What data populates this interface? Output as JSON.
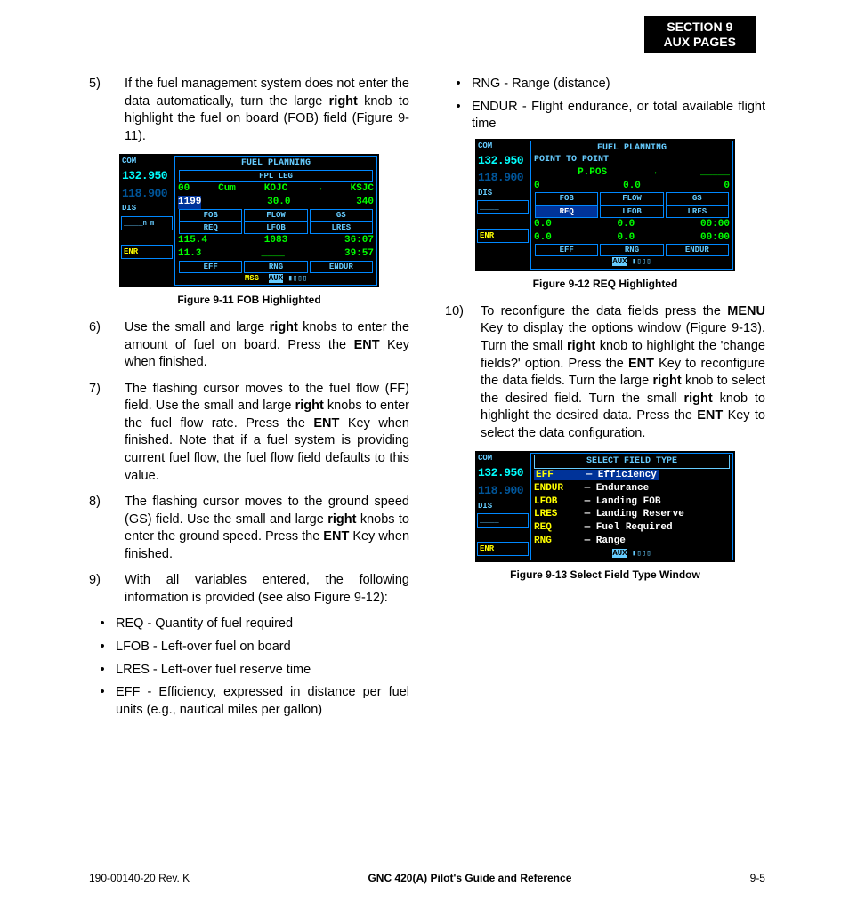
{
  "header": {
    "line1": "SECTION 9",
    "line2": "AUX PAGES"
  },
  "left": {
    "i5": {
      "n": "5)",
      "t": "If the fuel management system does not enter the data automatically, turn the large <b>right</b> knob to highlight the fuel on board (FOB) field (Figure 9-11)."
    },
    "fig11_cap": "Figure 9-11  FOB Highlighted",
    "i6": {
      "n": "6)",
      "t": "Use the small and large <b>right</b> knobs to enter the amount of fuel on board.  Press the <b>ENT</b> Key when finished."
    },
    "i7": {
      "n": "7)",
      "t": "The flashing cursor moves to the fuel flow (FF) field.  Use the small and large <b>right</b> knobs to enter the fuel flow rate.  Press the <b>ENT</b> Key when finished.  Note that if a fuel system is providing current fuel flow, the fuel flow field defaults to this value."
    },
    "i8": {
      "n": "8)",
      "t": "The flashing cursor moves to the ground speed (GS) field. Use the small and large <b>right</b> knobs to enter the ground speed.  Press the <b>ENT</b> Key when finished."
    },
    "i9": {
      "n": "9)",
      "t": "With all variables entered, the following information is provided (see also Figure 9-12):"
    },
    "b1": "REQ - Quantity of fuel required",
    "b2": "LFOB - Left-over fuel on board",
    "b3": "LRES - Left-over fuel reserve time",
    "b4": "EFF - Efficiency, expressed in distance per fuel units (e.g., nautical miles per gallon)"
  },
  "right": {
    "b5": "RNG - Range (distance)",
    "b6": "ENDUR - Flight endurance, or total available flight time",
    "fig12_cap": "Figure 9-12  REQ Highlighted",
    "i10": {
      "n": "10)",
      "t": "To reconfigure the data fields press the <b>MENU</b> Key to display the options window (Figure 9-13).  Turn the small <b>right</b> knob to highlight the 'change fields?' option.  Press the <b>ENT</b> Key to reconfigure the data fields.  Turn the large <b>right</b> knob to select the desired field.  Turn the small <b>right</b> knob to highlight the desired data.  Press the <b>ENT</b> Key to select the data configuration."
    },
    "fig13_cap": "Figure 9-13  Select Field Type Window"
  },
  "gps_common": {
    "com": "COM",
    "freq": "132.950",
    "freq2": "118.900",
    "dis": "DIS",
    "enr": "ENR",
    "n_m": "n m"
  },
  "fig11": {
    "title": "FUEL PLANNING",
    "sub": "FPL  LEG",
    "r1": [
      "00",
      "Cum",
      "KOJC",
      "→",
      "KSJC"
    ],
    "r2": [
      "1199",
      "30.0",
      "340"
    ],
    "hdr1": [
      "FOB",
      "FLOW",
      "GS"
    ],
    "hdr2": [
      "REQ",
      "LFOB",
      "LRES"
    ],
    "r3": [
      "115.4",
      "1083",
      "36:07"
    ],
    "r4": [
      "11.3",
      "____",
      "39:57"
    ],
    "hdr3": [
      "EFF",
      "RNG",
      "ENDUR"
    ],
    "msg": "MSG",
    "aux": "AUX"
  },
  "fig12": {
    "title": "FUEL PLANNING",
    "sub": "POINT TO POINT",
    "r1": [
      "",
      "P.POS",
      "→",
      "_____"
    ],
    "r2": [
      "0",
      "0.0",
      "0"
    ],
    "hdr1": [
      "FOB",
      "FLOW",
      "GS"
    ],
    "hdr2": [
      "REQ",
      "LFOB",
      "LRES"
    ],
    "r3": [
      "0.0",
      "0.0",
      "00:00"
    ],
    "r4": [
      "0.0",
      "0.0",
      "00:00"
    ],
    "hdr3": [
      "EFF",
      "RNG",
      "ENDUR"
    ],
    "aux": "AUX"
  },
  "fig13": {
    "title": "SELECT FIELD TYPE",
    "rows": [
      [
        "EFF",
        "— Efficiency"
      ],
      [
        "ENDUR",
        "— Endurance"
      ],
      [
        "LFOB",
        "— Landing FOB"
      ],
      [
        "LRES",
        "— Landing Reserve"
      ],
      [
        "REQ",
        "— Fuel Required"
      ],
      [
        "RNG",
        "— Range"
      ]
    ],
    "aux": "AUX"
  },
  "footer": {
    "left": "190-00140-20  Rev. K",
    "center": "GNC 420(A) Pilot's Guide and Reference",
    "right": "9-5"
  }
}
